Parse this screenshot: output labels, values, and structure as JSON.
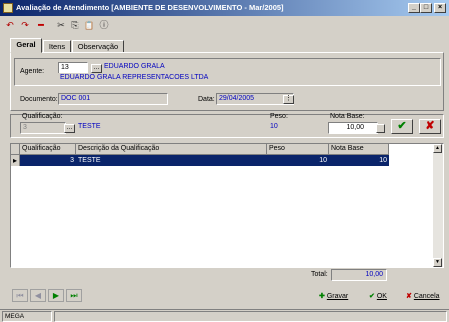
{
  "window": {
    "title": "Avaliação de Atendimento [AMBIENTE DE DESENVOLVIMENTO - Mar/2005]",
    "min_glyph": "_",
    "max_glyph": "□",
    "close_glyph": "×"
  },
  "toolbar": {
    "undo_glyph": "↶",
    "redo_glyph": "↷",
    "delete_glyph": "━",
    "cut_glyph": "✂",
    "copy_glyph": "⎘",
    "paste_glyph": "📋",
    "info_glyph": "ⓘ"
  },
  "tabs": [
    {
      "label": "Geral"
    },
    {
      "label": "Itens"
    },
    {
      "label": "Observação"
    }
  ],
  "form": {
    "agente_label": "Agente:",
    "agente_code": "13",
    "agente_name": "EDUARDO GRALA",
    "agente_company": "EDUARDO GRALA REPRESENTACOES LTDA",
    "documento_label": "Documento:",
    "documento_value": "DOC 001",
    "data_label": "Data:",
    "data_value": "29/04/2005",
    "lookup_glyph": "...",
    "cal_glyph": "⋮"
  },
  "item_entry": {
    "qualificacao_label": "Qualificação:",
    "qualificacao_code": "3",
    "qualificacao_desc": "TESTE",
    "peso_label": "Peso:",
    "peso_value": "10",
    "nota_label": "Nota Base:",
    "nota_value": "10,00",
    "confirm_glyph": "✔",
    "cancel_glyph": "✘"
  },
  "grid": {
    "columns": [
      "Qualificação",
      "Descrição da Qualificação",
      "Peso",
      "Nota Base"
    ],
    "rows": [
      {
        "qualificacao": "3",
        "descricao": "TESTE",
        "peso": "10",
        "nota": "10"
      }
    ],
    "row_marker": "▸",
    "scroll_up": "▲",
    "scroll_down": "▼"
  },
  "total": {
    "label": "Total:",
    "value": "10,00"
  },
  "nav": {
    "first": "⏮",
    "prev": "◀",
    "next": "▶",
    "last": "⏭"
  },
  "actions": {
    "gravar": "Gravar",
    "ok": "OK",
    "cancela": "Cancela"
  },
  "status": {
    "text": "MEGA"
  },
  "colors": {
    "title_start": "#0a246a",
    "title_end": "#a6caf0",
    "selection": "#0a246a",
    "confirm_green": "#008000",
    "cancel_red": "#c00000"
  }
}
